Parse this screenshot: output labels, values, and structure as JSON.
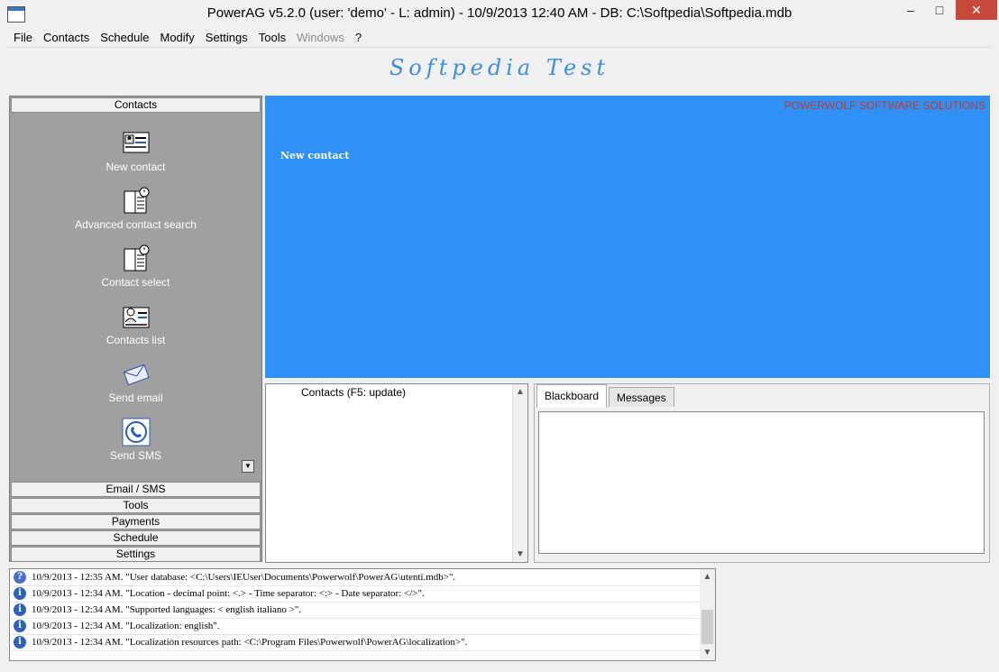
{
  "window": {
    "title": "PowerAG v5.2.0  (user: 'demo'  - L: admin) - 10/9/2013 12:40 AM - DB: C:\\Softpedia\\Softpedia.mdb",
    "minimize": "–",
    "maximize": "□",
    "close": "✕"
  },
  "menu": [
    "File",
    "Contacts",
    "Schedule",
    "Modify",
    "Settings",
    "Tools",
    "Windows",
    "?"
  ],
  "banner": "Softpedia Test",
  "sidebar": {
    "top_header": "Contacts",
    "tools": [
      {
        "label": "New contact",
        "icon": "contact-card-icon"
      },
      {
        "label": "Advanced contact search",
        "icon": "notebook-clock-icon"
      },
      {
        "label": "Contact select",
        "icon": "notebook-clock-icon"
      },
      {
        "label": "Contacts list",
        "icon": "contacts-list-icon"
      },
      {
        "label": "Send email",
        "icon": "envelope-icon"
      },
      {
        "label": "Send SMS",
        "icon": "phone-icon"
      }
    ],
    "bottom_headers": [
      "Email / SMS",
      "Tools",
      "Payments",
      "Schedule",
      "Settings"
    ]
  },
  "main_panel": {
    "brand": "POWERWOLF SOFTWARE SOLUTIONS",
    "new_contact_label": "New contact"
  },
  "contacts_panel": {
    "header": "Contacts  (F5: update)"
  },
  "tabs": [
    "Blackboard",
    "Messages"
  ],
  "log": [
    {
      "icon": "question",
      "text": "10/9/2013 - 12:35 AM. \"User database: <C:\\Users\\IEUser\\Documents\\Powerwolf\\PowerAG\\utenti.mdb>\"."
    },
    {
      "icon": "info",
      "text": "10/9/2013 - 12:34 AM. \"Location - decimal point: <.> - Time separator: <:> - Date separator: </>\"."
    },
    {
      "icon": "info",
      "text": "10/9/2013 - 12:34 AM. \"Supported languages: < english italiano >\"."
    },
    {
      "icon": "info",
      "text": "10/9/2013 - 12:34 AM. \"Localization: english\"."
    },
    {
      "icon": "info",
      "text": "10/9/2013 - 12:34 AM. \"Localization resources path: <C:\\Program Files\\Powerwolf\\PowerAG\\localization>\"."
    }
  ],
  "colors": {
    "blue_panel": "#3190f5",
    "banner_text": "#3c8fdd",
    "brand_text": "#c0392b",
    "sidebar_bg": "#a0a0a0"
  }
}
